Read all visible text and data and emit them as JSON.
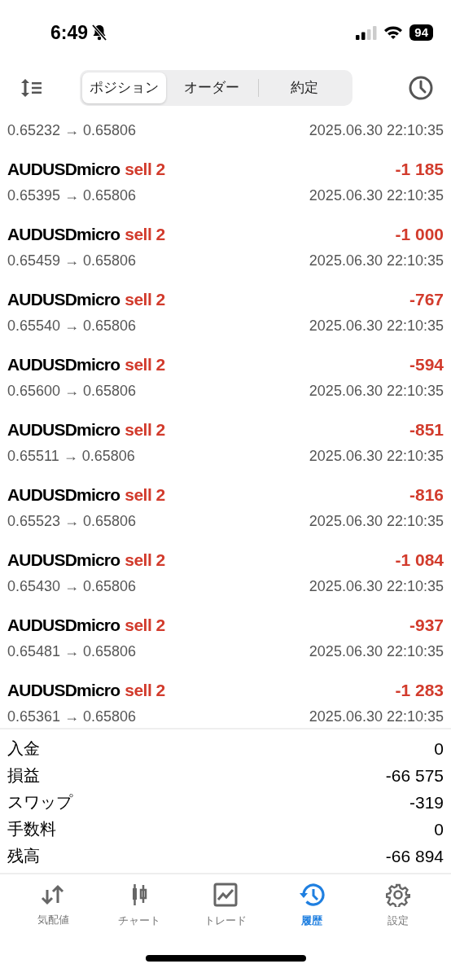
{
  "status_bar": {
    "time": "6:49",
    "battery": "94"
  },
  "segments": [
    {
      "label": "ポジション",
      "selected": true
    },
    {
      "label": "オーダー",
      "selected": false
    },
    {
      "label": "約定",
      "selected": false
    }
  ],
  "deals": [
    {
      "prices": "0.65232 → 0.65806",
      "time": "2025.06.30 22:10:35"
    },
    {
      "symbol": "AUDUSDmicro",
      "side": "sell 2",
      "profit": "-1 185",
      "prices": "0.65395 → 0.65806",
      "time": "2025.06.30 22:10:35"
    },
    {
      "symbol": "AUDUSDmicro",
      "side": "sell 2",
      "profit": "-1 000",
      "prices": "0.65459 → 0.65806",
      "time": "2025.06.30 22:10:35"
    },
    {
      "symbol": "AUDUSDmicro",
      "side": "sell 2",
      "profit": "-767",
      "prices": "0.65540 → 0.65806",
      "time": "2025.06.30 22:10:35"
    },
    {
      "symbol": "AUDUSDmicro",
      "side": "sell 2",
      "profit": "-594",
      "prices": "0.65600 → 0.65806",
      "time": "2025.06.30 22:10:35"
    },
    {
      "symbol": "AUDUSDmicro",
      "side": "sell 2",
      "profit": "-851",
      "prices": "0.65511 → 0.65806",
      "time": "2025.06.30 22:10:35"
    },
    {
      "symbol": "AUDUSDmicro",
      "side": "sell 2",
      "profit": "-816",
      "prices": "0.65523 → 0.65806",
      "time": "2025.06.30 22:10:35"
    },
    {
      "symbol": "AUDUSDmicro",
      "side": "sell 2",
      "profit": "-1 084",
      "prices": "0.65430 → 0.65806",
      "time": "2025.06.30 22:10:35"
    },
    {
      "symbol": "AUDUSDmicro",
      "side": "sell 2",
      "profit": "-937",
      "prices": "0.65481 → 0.65806",
      "time": "2025.06.30 22:10:35"
    },
    {
      "symbol": "AUDUSDmicro",
      "side": "sell 2",
      "profit": "-1 283",
      "prices": "0.65361 → 0.65806",
      "time": "2025.06.30 22:10:35"
    }
  ],
  "summary": [
    {
      "label": "入金",
      "value": "0"
    },
    {
      "label": "損益",
      "value": "-66 575"
    },
    {
      "label": "スワップ",
      "value": "-319"
    },
    {
      "label": "手数料",
      "value": "0"
    },
    {
      "label": "残高",
      "value": "-66 894"
    }
  ],
  "tab_bar": [
    {
      "label": "気配値",
      "kind": "quotes",
      "selected": false
    },
    {
      "label": "チャート",
      "kind": "chart",
      "selected": false
    },
    {
      "label": "トレード",
      "kind": "trade",
      "selected": false
    },
    {
      "label": "履歴",
      "kind": "history",
      "selected": true
    },
    {
      "label": "設定",
      "kind": "settings",
      "selected": false
    }
  ]
}
